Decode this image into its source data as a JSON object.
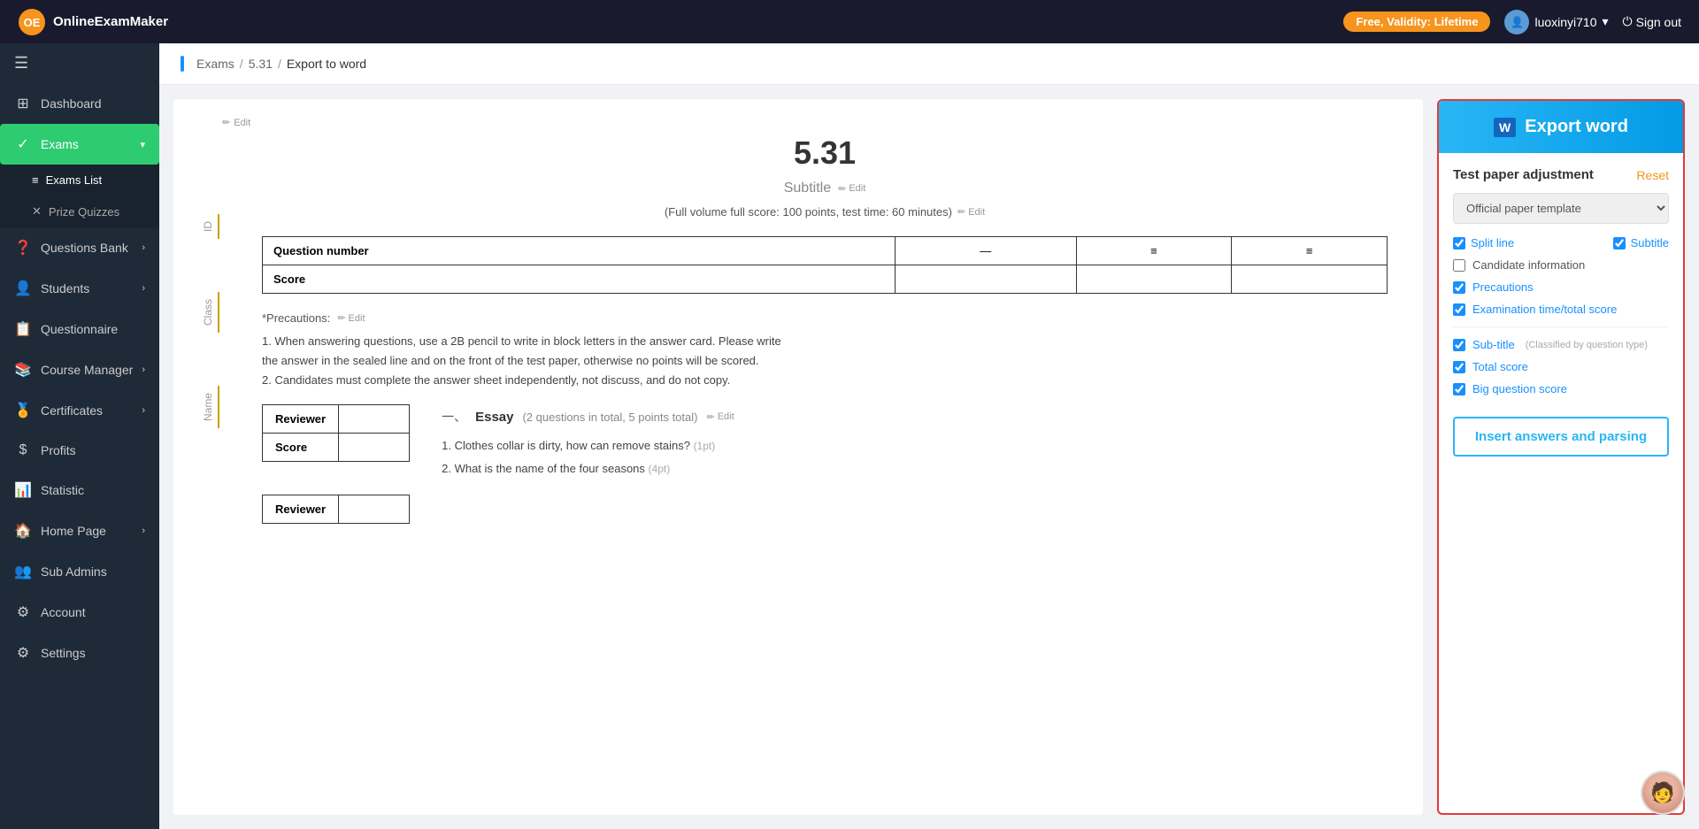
{
  "topbar": {
    "logo_text": "OnlineExamMaker",
    "badge_text": "Free, Validity: Lifetime",
    "user_name": "luoxinyi710",
    "signout_label": "Sign out"
  },
  "sidebar": {
    "toggle_icon": "☰",
    "items": [
      {
        "id": "dashboard",
        "label": "Dashboard",
        "icon": "⊞",
        "active": false
      },
      {
        "id": "exams",
        "label": "Exams",
        "icon": "✓",
        "active": true,
        "expanded": true
      },
      {
        "id": "exams-list",
        "label": "Exams List",
        "icon": "≡",
        "sub": true
      },
      {
        "id": "prize-quizzes",
        "label": "Prize Quizzes",
        "icon": "✕",
        "sub": true
      },
      {
        "id": "questions-bank",
        "label": "Questions Bank",
        "icon": "❓",
        "active": false
      },
      {
        "id": "students",
        "label": "Students",
        "icon": "👤",
        "active": false
      },
      {
        "id": "questionnaire",
        "label": "Questionnaire",
        "icon": "📋",
        "active": false
      },
      {
        "id": "course-manager",
        "label": "Course Manager",
        "icon": "📚",
        "active": false
      },
      {
        "id": "certificates",
        "label": "Certificates",
        "icon": "🏅",
        "active": false
      },
      {
        "id": "profits",
        "label": "Profits",
        "icon": "$",
        "active": false
      },
      {
        "id": "statistic",
        "label": "Statistic",
        "icon": "📊",
        "active": false
      },
      {
        "id": "home-page",
        "label": "Home Page",
        "icon": "🏠",
        "active": false
      },
      {
        "id": "sub-admins",
        "label": "Sub Admins",
        "icon": "👥",
        "active": false
      },
      {
        "id": "account",
        "label": "Account",
        "icon": "⚙",
        "active": false
      },
      {
        "id": "settings",
        "label": "Settings",
        "icon": "⚙",
        "active": false
      }
    ]
  },
  "breadcrumb": {
    "parts": [
      "Exams",
      "5.31",
      "Export to word"
    ]
  },
  "document": {
    "title": "5.31",
    "subtitle": "Subtitle",
    "subtitle_edit": "Edit",
    "fullscore_text": "(Full volume full score: 100 points, test time: 60 minutes)",
    "fullscore_edit": "Edit",
    "table": {
      "col1": "Question number",
      "col2": "Score",
      "icons": [
        "—",
        "≡",
        "≡"
      ]
    },
    "precautions_label": "*Precautions:",
    "precautions_edit": "Edit",
    "precautions_lines": [
      "1. When answering questions, use a 2B pencil to write in block letters in the answer card. Please write",
      "the answer in the sealed line and on the front of the test paper, otherwise no points will be scored.",
      "2. Candidates must complete the answer sheet independently, not discuss, and do not copy."
    ],
    "section1": {
      "num": "一、",
      "title": "Essay",
      "info": "(2 questions in total, 5 points total)",
      "edit": "Edit"
    },
    "questions": [
      {
        "num": "1.",
        "text": "Clothes collar is dirty, how can remove stains?",
        "pts": "(1pt)"
      },
      {
        "num": "2.",
        "text": "What is the name of the four seasons",
        "pts": "(4pt)"
      }
    ],
    "reviewer_label": "Reviewer",
    "score_label": "Score",
    "side_labels": [
      "Edit",
      "ID",
      "Class",
      "Name"
    ],
    "bottom_reviewer": "Reviewer"
  },
  "panel": {
    "export_label": "Export word",
    "section_title": "Test paper adjustment",
    "reset_label": "Reset",
    "template_options": [
      "Official paper template"
    ],
    "template_selected": "Official paper template",
    "checkboxes": {
      "split_line": {
        "label": "Split line",
        "checked": true
      },
      "subtitle": {
        "label": "Subtitle",
        "checked": true
      },
      "candidate_info": {
        "label": "Candidate information",
        "checked": false
      },
      "precautions": {
        "label": "Precautions",
        "checked": true
      },
      "exam_time": {
        "label": "Examination time/total score",
        "checked": true
      },
      "sub_title": {
        "label": "Sub-title",
        "note": "(Classified by question type)",
        "checked": true
      },
      "total_score": {
        "label": "Total score",
        "checked": true
      },
      "big_question_score": {
        "label": "Big question score",
        "checked": true
      }
    },
    "insert_btn": "Insert answers and parsing"
  }
}
